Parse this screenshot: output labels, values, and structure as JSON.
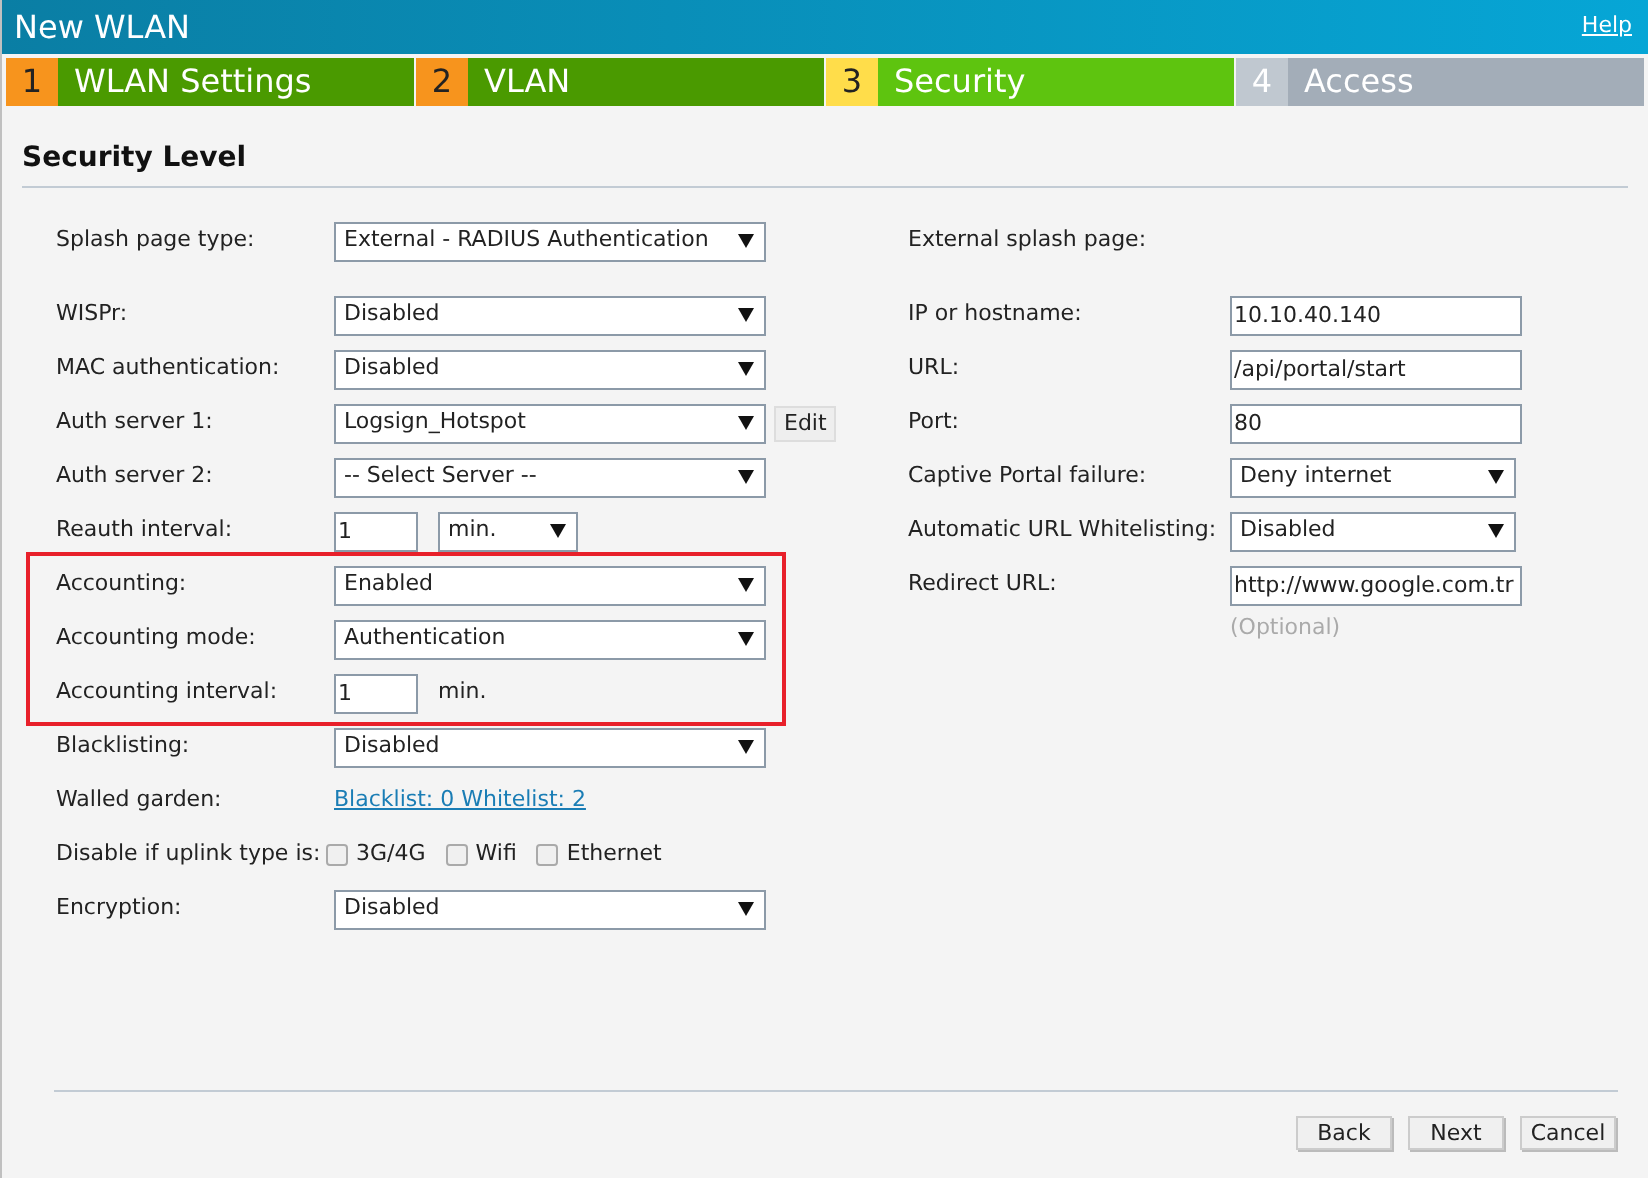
{
  "window": {
    "title": "New WLAN",
    "help_link": "Help"
  },
  "steps": [
    {
      "number": "1",
      "label": "WLAN Settings",
      "selected": false
    },
    {
      "number": "2",
      "label": "VLAN",
      "selected": false
    },
    {
      "number": "3",
      "label": "Security",
      "selected": true
    },
    {
      "number": "4",
      "label": "Access",
      "selected": false
    }
  ],
  "section_title": "Security Level",
  "left": {
    "header_row": {
      "kind": "select",
      "label": "Splash page type:",
      "value": "External - RADIUS Authentication"
    },
    "rows": [
      {
        "kind": "select",
        "label": "WISPr:",
        "value": "Disabled",
        "highlighted": false
      },
      {
        "kind": "select",
        "label": "MAC authentication:",
        "value": "Disabled",
        "highlighted": false
      },
      {
        "kind": "select",
        "label": "Auth server 1:",
        "value": "Logsign_Hotspot",
        "button": "Edit",
        "highlighted": false
      },
      {
        "kind": "select",
        "label": "Auth server 2:",
        "value": "-- Select Server --",
        "highlighted": false
      },
      {
        "kind": "input_unit",
        "label": "Reauth interval:",
        "value": "1",
        "unit": {
          "kind": "select",
          "value": "min."
        },
        "highlighted": false
      },
      {
        "kind": "select",
        "label": "Accounting:",
        "value": "Enabled",
        "highlighted": true
      },
      {
        "kind": "select",
        "label": "Accounting mode:",
        "value": "Authentication",
        "highlighted": true
      },
      {
        "kind": "input_unit",
        "label": "Accounting interval:",
        "value": "1",
        "unit": {
          "kind": "text",
          "value": "min."
        },
        "highlighted": true
      },
      {
        "kind": "select",
        "label": "Blacklisting:",
        "value": "Disabled",
        "highlighted": false
      },
      {
        "kind": "link",
        "label": "Walled garden:",
        "value": "Blacklist: 0 Whitelist: 2",
        "highlighted": false
      },
      {
        "kind": "checks",
        "label": "Disable if uplink type is:",
        "options": [
          {
            "label": "3G/4G",
            "checked": false
          },
          {
            "label": "Wifi",
            "checked": false
          },
          {
            "label": "Ethernet",
            "checked": false
          }
        ],
        "highlighted": false
      },
      {
        "kind": "select",
        "label": "Encryption:",
        "value": "Disabled",
        "highlighted": false
      }
    ]
  },
  "right": {
    "header": "External splash page:",
    "rows": [
      {
        "kind": "input",
        "label": "IP or hostname:",
        "value": "10.10.40.140"
      },
      {
        "kind": "input",
        "label": "URL:",
        "value": "/api/portal/start"
      },
      {
        "kind": "input",
        "label": "Port:",
        "value": "80"
      },
      {
        "kind": "select",
        "label": "Captive Portal failure:",
        "value": "Deny internet"
      },
      {
        "kind": "select",
        "label": "Automatic URL Whitelisting:",
        "value": "Disabled"
      },
      {
        "kind": "input",
        "label": "Redirect URL:",
        "value": "http://www.google.com.tr",
        "hint": "(Optional)"
      }
    ]
  },
  "buttons": [
    "Back",
    "Next",
    "Cancel"
  ]
}
